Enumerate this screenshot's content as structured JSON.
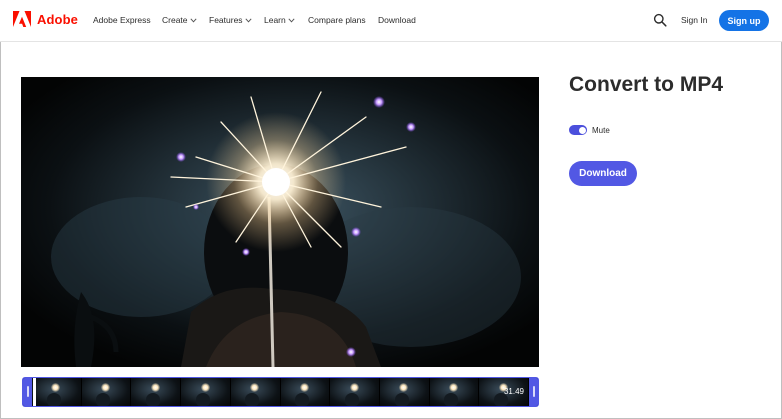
{
  "brand": {
    "name": "Adobe",
    "color": "#fa0f00",
    "icon": "adobe-logo"
  },
  "nav": {
    "items": [
      {
        "label": "Adobe Express",
        "has_dropdown": false
      },
      {
        "label": "Create",
        "has_dropdown": true
      },
      {
        "label": "Features",
        "has_dropdown": true
      },
      {
        "label": "Learn",
        "has_dropdown": true
      },
      {
        "label": "Compare plans",
        "has_dropdown": false
      },
      {
        "label": "Download",
        "has_dropdown": false
      }
    ],
    "search_icon": "search-icon",
    "signin_label": "Sign In",
    "signup_label": "Sign up",
    "signup_color": "#1473e6"
  },
  "main": {
    "title": "Convert to MP4",
    "mute": {
      "label": "Mute",
      "on": true
    },
    "download_label": "Download",
    "accent_color": "#5258e4"
  },
  "timeline": {
    "time_label": "31.49",
    "frame_count": 10
  }
}
